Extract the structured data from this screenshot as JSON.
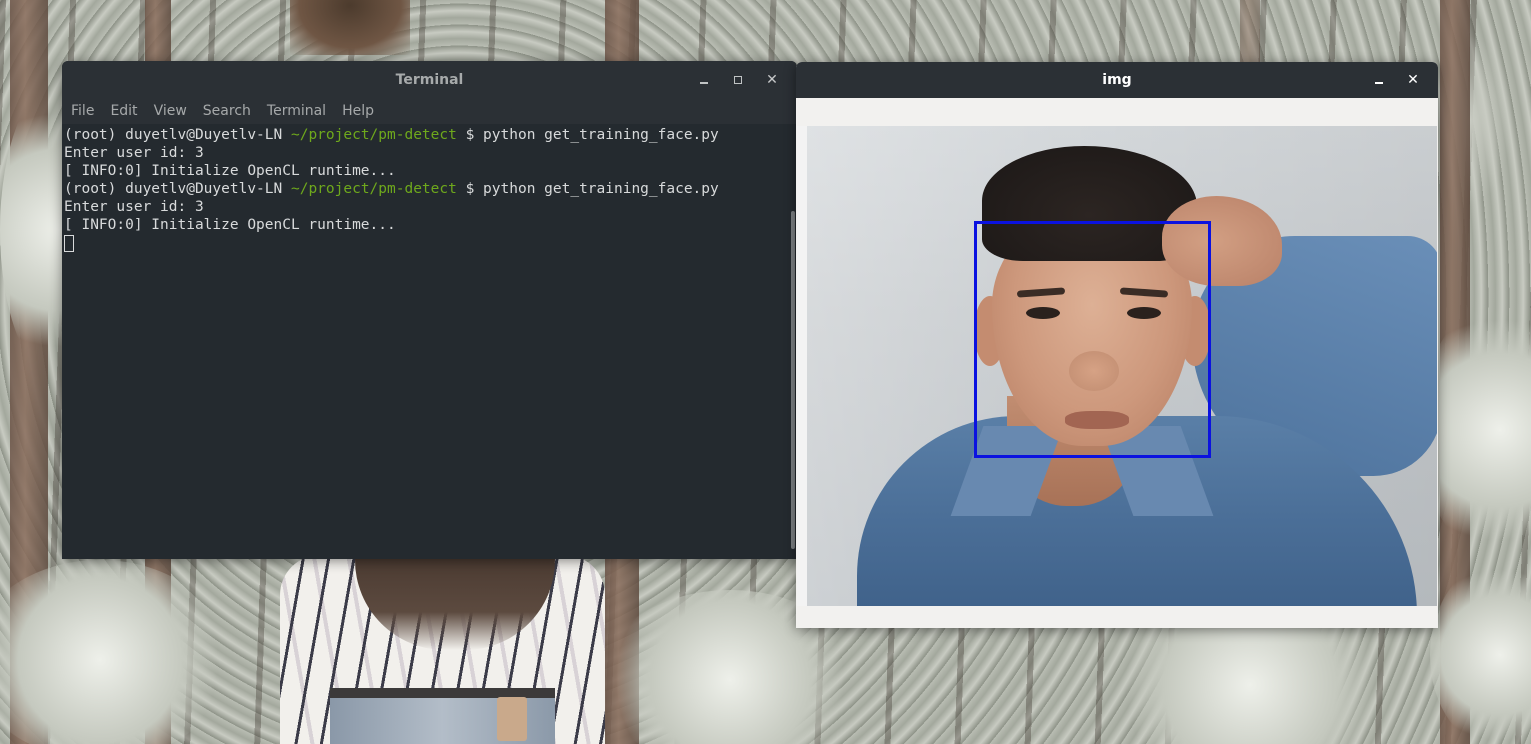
{
  "terminal": {
    "title": "Terminal",
    "menu": [
      "File",
      "Edit",
      "View",
      "Search",
      "Terminal",
      "Help"
    ],
    "lines": [
      {
        "prefix": "(root) duyetlv@Duyetlv-LN ",
        "path": "~/project/pm-detect",
        "suffix": " $ python get_training_face.py"
      },
      {
        "text": "Enter user id: 3"
      },
      {
        "text": "[ INFO:0] Initialize OpenCL runtime..."
      },
      {
        "prefix": "(root) duyetlv@Duyetlv-LN ",
        "path": "~/project/pm-detect",
        "suffix": " $ python get_training_face.py"
      },
      {
        "text": "Enter user id: 3"
      },
      {
        "text": "[ INFO:0] Initialize OpenCL runtime..."
      }
    ],
    "colors": {
      "background": "#242a2f",
      "text": "#d8dadb",
      "path": "#6ea81c"
    }
  },
  "img_window": {
    "title": "img",
    "face_box_color": "#0b12e0"
  },
  "window_controls": {
    "minimize_icon": "minimize-icon",
    "maximize_icon": "maximize-icon",
    "close_icon": "close-icon"
  }
}
